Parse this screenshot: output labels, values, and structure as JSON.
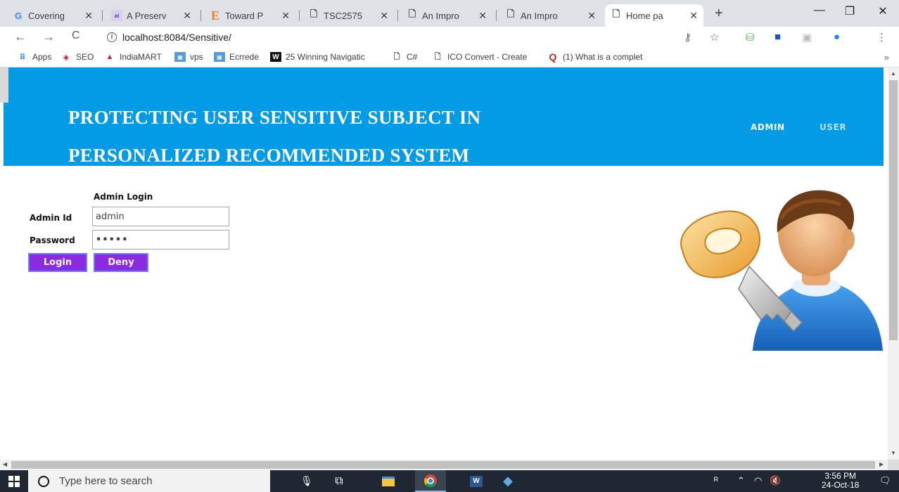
{
  "browser": {
    "tabs": [
      {
        "title": "Covering",
        "icon": "google-icon"
      },
      {
        "title": "A Preserv",
        "icon": "site-icon"
      },
      {
        "title": "Toward P",
        "icon": "e-letter-icon"
      },
      {
        "title": "TSC2575",
        "icon": "page-icon"
      },
      {
        "title": "An Impro",
        "icon": "page-icon"
      },
      {
        "title": "An Impro",
        "icon": "page-icon"
      },
      {
        "title": "Home pa",
        "icon": "page-icon"
      }
    ],
    "url": "localhost:8084/Sensitive/",
    "bookmarks": [
      {
        "label": "Apps"
      },
      {
        "label": "SEO"
      },
      {
        "label": "IndiaMART"
      },
      {
        "label": "vps"
      },
      {
        "label": "Ecrrede"
      },
      {
        "label": "25 Winning Navigatic"
      },
      {
        "label": "C#"
      },
      {
        "label": "ICO Convert - Create"
      },
      {
        "label": "(1) What is a complet"
      }
    ],
    "bookmarks_more": "»"
  },
  "site": {
    "title_line1": "PROTECTING USER SENSITIVE SUBJECT IN",
    "title_line2": "PERSONALIZED RECOMMENDED SYSTEM",
    "nav": {
      "admin": "ADMIN",
      "user": "USER"
    },
    "header_color": "#039be5"
  },
  "login": {
    "heading": "Admin Login",
    "id_label": "Admin Id",
    "id_value": "admin",
    "password_label": "Password",
    "password_value": "•••••",
    "login_button": "Login",
    "deny_button": "Deny",
    "button_color": "#8a2be2"
  },
  "taskbar": {
    "search_placeholder": "Type here to search",
    "time": "3:56 PM",
    "date": "24-Oct-18"
  }
}
